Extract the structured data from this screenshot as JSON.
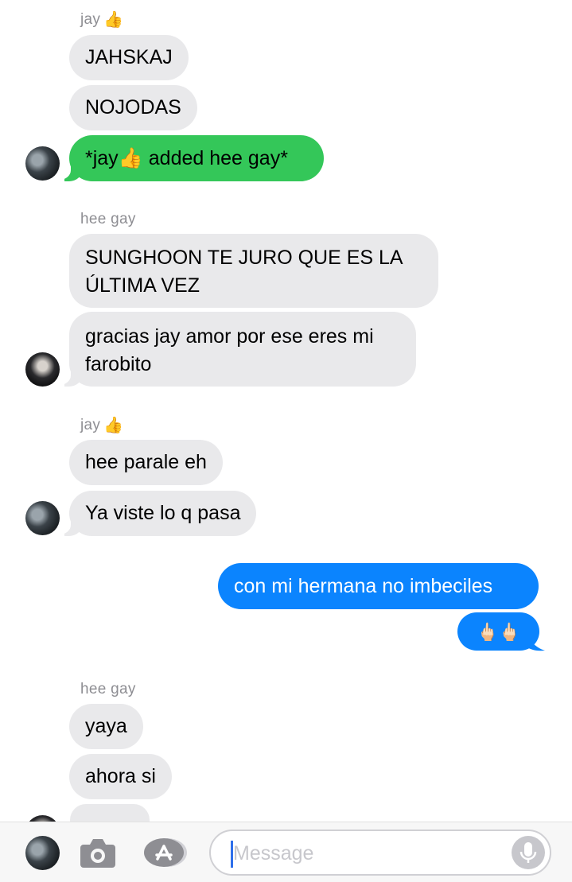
{
  "conversation": {
    "group1": {
      "sender": "jay",
      "sender_emoji": "👍",
      "messages": [
        "JAHSKAJ",
        "NOJODAS"
      ],
      "green_message": "*jay👍 added hee gay*"
    },
    "group2": {
      "sender": "hee gay",
      "messages": [
        "SUNGHOON TE JURO QUE ES LA ÚLTIMA VEZ",
        "gracias jay amor por ese eres mi farobito"
      ]
    },
    "group3": {
      "sender": "jay",
      "sender_emoji": "👍",
      "messages": [
        "hee parale eh",
        "Ya viste lo q pasa"
      ]
    },
    "outgoing": {
      "messages": [
        "con mi hermana no imbeciles",
        "🖕🏻🖕🏻"
      ]
    },
    "group4": {
      "sender": "hee gay",
      "messages": [
        "yaya",
        "ahora si"
      ]
    }
  },
  "input": {
    "placeholder": "Message",
    "camera_icon": "camera-icon",
    "apps_icon": "app-store-icon",
    "mic_icon": "microphone-icon"
  },
  "colors": {
    "incoming_bubble": "#e9e9eb",
    "green_bubble": "#34c759",
    "blue_bubble": "#0b84fe",
    "sender_label": "#8e8e93"
  }
}
